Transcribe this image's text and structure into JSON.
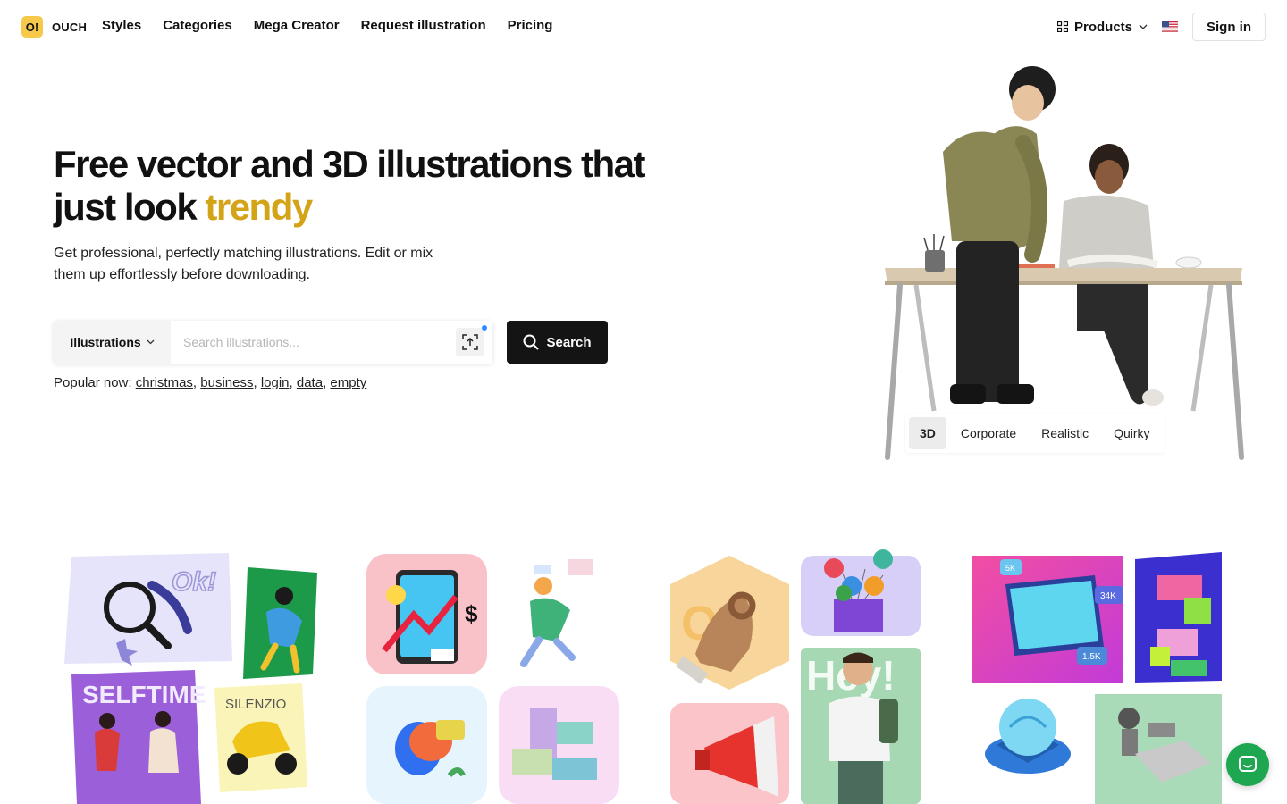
{
  "brand": {
    "logo_mark": "O!",
    "name": "OUCH",
    "accent_color": "#d4a418"
  },
  "nav": {
    "items": [
      {
        "label": "Styles"
      },
      {
        "label": "Categories"
      },
      {
        "label": "Mega Creator"
      },
      {
        "label": "Request illustration"
      },
      {
        "label": "Pricing"
      }
    ],
    "products_label": "Products",
    "signin_label": "Sign in"
  },
  "hero": {
    "title_part1": "Free vector and 3D illustrations that just look ",
    "title_accent": "trendy",
    "subtitle": "Get professional, perfectly matching illustrations. Edit or mix them up effortlessly before downloading."
  },
  "search": {
    "type_selected": "Illustrations",
    "placeholder": "Search illustrations...",
    "button_label": "Search"
  },
  "popular": {
    "label": "Popular now:",
    "tags": [
      "christmas",
      "business",
      "login",
      "data",
      "empty"
    ]
  },
  "style_tabs": [
    {
      "label": "3D",
      "active": true
    },
    {
      "label": "Corporate",
      "active": false
    },
    {
      "label": "Realistic",
      "active": false
    },
    {
      "label": "Quirky",
      "active": false
    }
  ],
  "gallery": {
    "texts": {
      "ok": "Ok!",
      "selftime": "SELFTIME",
      "silenzio": "SILENZIO",
      "hey": "Hey!",
      "dollar": "$",
      "ok_big": "OK",
      "stat1": "34K",
      "stat2": "1.5K",
      "stat3": "5K"
    }
  }
}
